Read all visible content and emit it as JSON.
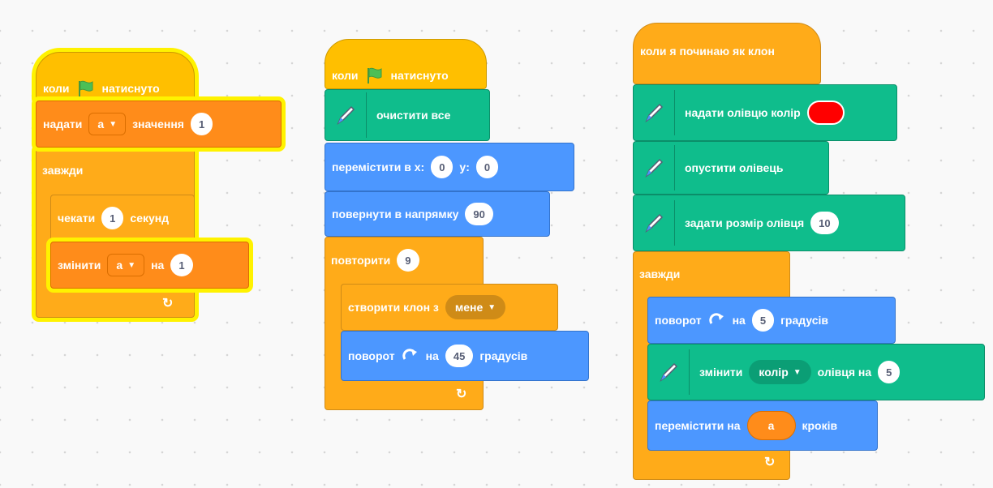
{
  "scripts": [
    {
      "hat": {
        "label1": "коли",
        "label2": "натиснуто"
      },
      "set_var": {
        "label1": "надати",
        "var": "а",
        "label2": "значення",
        "value": "1"
      },
      "forever": {
        "label": "завжди",
        "loop_icon": "↻"
      },
      "wait": {
        "label1": "чекати",
        "value": "1",
        "label2": "секунд"
      },
      "change_var": {
        "label1": "змінити",
        "var": "а",
        "label2": "на",
        "value": "1"
      }
    },
    {
      "hat": {
        "label1": "коли",
        "label2": "натиснуто"
      },
      "clear": {
        "label": "очистити все"
      },
      "goto": {
        "label1": "перемістити в x:",
        "x": "0",
        "label2": "y:",
        "y": "0"
      },
      "point": {
        "label": "повернути в напрямку",
        "value": "90"
      },
      "repeat": {
        "label": "повторити",
        "value": "9",
        "loop_icon": "↻"
      },
      "clone": {
        "label": "створити клон з",
        "target": "мене"
      },
      "turn": {
        "label1": "поворот",
        "label2": "на",
        "value": "45",
        "label3": "градусів"
      }
    },
    {
      "hat": {
        "label": "коли я починаю як клон"
      },
      "set_color": {
        "label": "надати олівцю колір",
        "color": "#FF0000"
      },
      "pen_down": {
        "label": "опустити олівець"
      },
      "set_size": {
        "label": "задати розмір олівця",
        "value": "10"
      },
      "forever": {
        "label": "завжди",
        "loop_icon": "↻"
      },
      "turn": {
        "label1": "поворот",
        "label2": "на",
        "value": "5",
        "label3": "градусів"
      },
      "change_pen": {
        "label1": "змінити",
        "param": "колір",
        "label2": "олівця на",
        "value": "5"
      },
      "move": {
        "label1": "перемістити на",
        "var": "а",
        "label2": "кроків"
      }
    }
  ],
  "icons": {
    "flag": "green-flag-icon",
    "pen": "pen-icon",
    "rotate": "rotate-right-icon",
    "dropdown": "▼"
  },
  "colors": {
    "events": "#FFBF00",
    "control": "#FFAB19",
    "variables": "#FF8C1A",
    "motion": "#4C97FF",
    "pen": "#0FBD8C",
    "highlight": "#FFF200"
  }
}
